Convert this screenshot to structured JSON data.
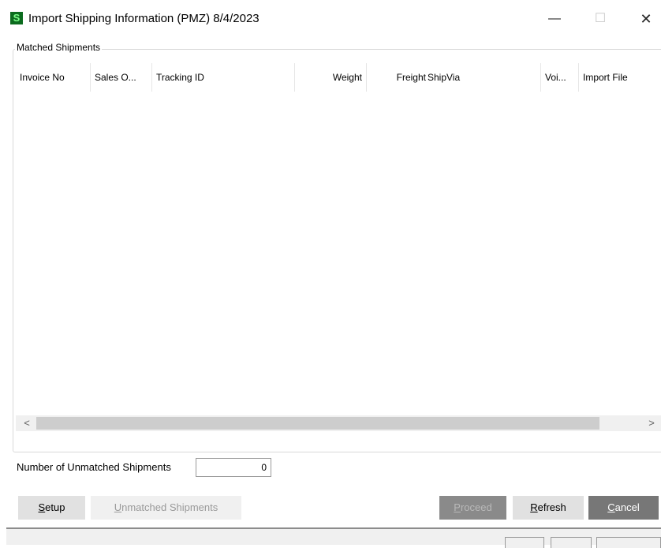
{
  "window": {
    "title": "Import Shipping Information (PMZ) 8/4/2023",
    "icon_letter": "S",
    "minimize_glyph": "—",
    "maximize_glyph": "☐",
    "close_glyph": "✕"
  },
  "matched_shipments": {
    "group_label": "Matched Shipments",
    "columns": [
      "Invoice No",
      "Sales O...",
      "Tracking ID",
      "Weight",
      "Freight",
      "ShipVia",
      "Voi...",
      "Import File"
    ],
    "rows": []
  },
  "scrollbar": {
    "left_glyph": "<",
    "right_glyph": ">"
  },
  "unmatched": {
    "label": "Number of Unmatched Shipments",
    "value": "0"
  },
  "buttons": {
    "setup": {
      "mnemonic": "S",
      "rest": "etup"
    },
    "unmatched": {
      "mnemonic": "U",
      "rest": "nmatched Shipments"
    },
    "proceed": {
      "mnemonic": "P",
      "rest": "roceed"
    },
    "refresh": {
      "mnemonic": "R",
      "rest": "efresh"
    },
    "cancel": {
      "mnemonic": "C",
      "rest": "ancel"
    }
  },
  "colors": {
    "icon_bg": "#0b6b1e",
    "button_bg": "#e1e1e1",
    "cancel_bg": "#777777"
  }
}
